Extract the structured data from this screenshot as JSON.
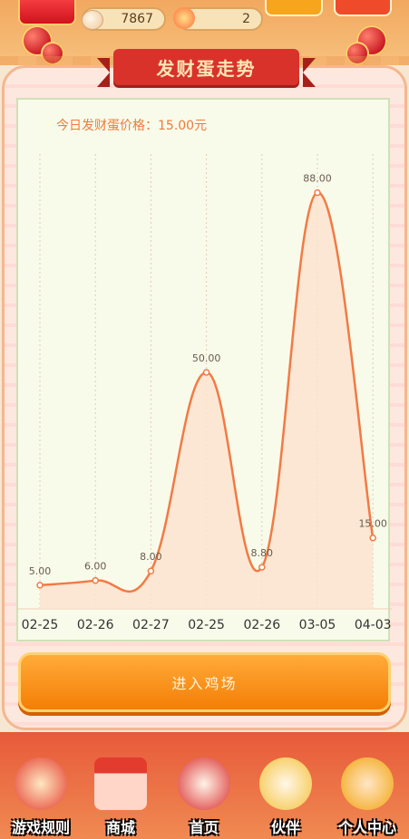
{
  "header": {
    "eggs": "7867",
    "chicks": "2"
  },
  "title": "发财蛋走势",
  "caption": "今日发财蛋价格：15.00元",
  "chart_data": {
    "type": "area",
    "categories": [
      "02-25",
      "02-26",
      "02-27",
      "02-25",
      "02-26",
      "03-05",
      "04-03"
    ],
    "values": [
      5.0,
      6.0,
      8.0,
      50.0,
      8.8,
      88.0,
      15.0
    ],
    "data_labels": [
      "5.00",
      "6.00",
      "8.00",
      "50.00",
      "8.80",
      "88.00",
      "15.00"
    ],
    "ylim": [
      0,
      100
    ],
    "colors": {
      "line": "#f27a45",
      "fill": "#fbe3cf",
      "grid": "#e4c9b5"
    }
  },
  "actions": {
    "enter": "进入鸡场"
  },
  "nav": [
    "游戏规则",
    "商城",
    "首页",
    "伙伴",
    "个人中心"
  ],
  "nav_icons": [
    "hen-red-icon",
    "shop-icon",
    "rooster-home-icon",
    "partners-icon",
    "avatar-icon"
  ]
}
